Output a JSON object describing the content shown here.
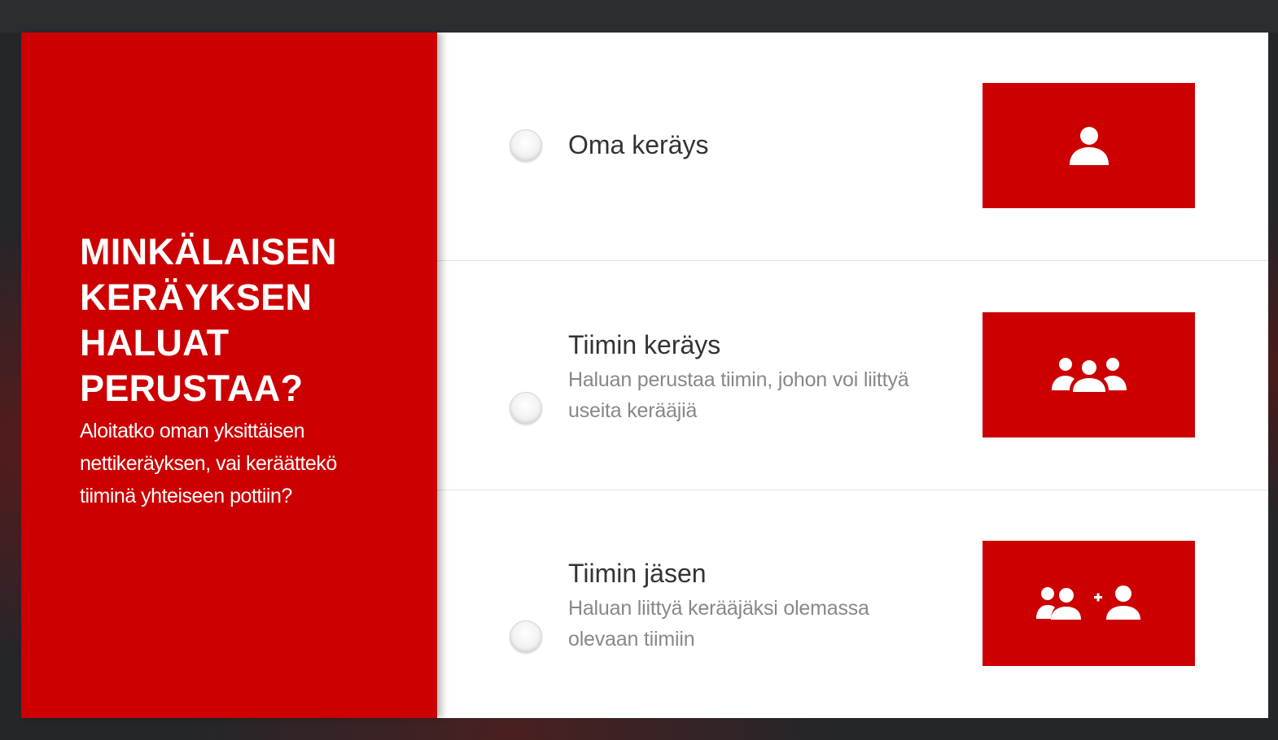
{
  "left_panel": {
    "heading_lines": [
      "MINKÄLAISEN",
      "KERÄYKSEN",
      "HALUAT",
      "PERUSTAA?"
    ],
    "subtext": "Aloitatko oman yksittäisen nettikeräyksen, vai keräättekö tiiminä yhteiseen pottiin?",
    "background_color": "#cc0000"
  },
  "options": [
    {
      "title": "Oma keräys",
      "description": "",
      "icon": "single-person-icon",
      "selected": false
    },
    {
      "title": "Tiimin keräys",
      "description": "Haluan perustaa tiimin, johon voi liittyä useita kerääjiä",
      "icon": "group-icon",
      "selected": false
    },
    {
      "title": "Tiimin jäsen",
      "description": "Haluan liittyä kerääjäksi olemassa olevaan tiimiin",
      "icon": "join-team-icon",
      "selected": false
    }
  ],
  "accent_color": "#cc0000"
}
